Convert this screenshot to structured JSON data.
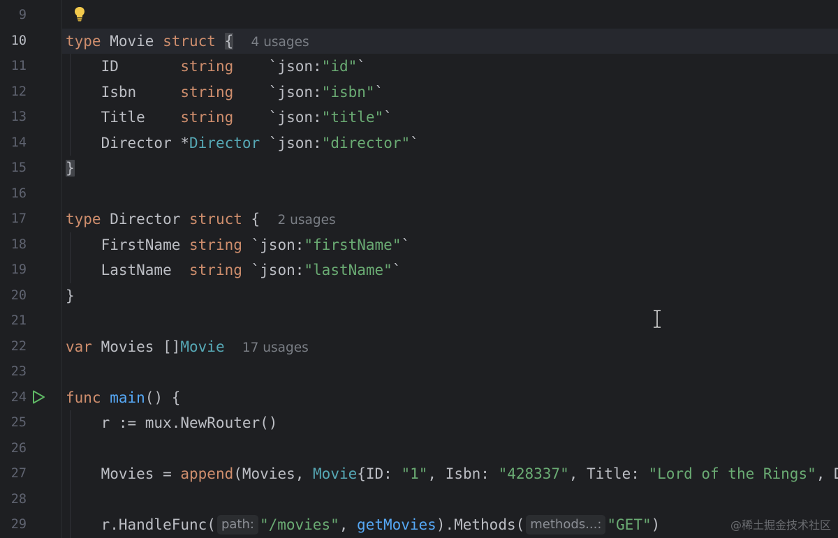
{
  "editor": {
    "language": "Go",
    "colors": {
      "background": "#1e1f22",
      "keyword": "#cf8e6d",
      "string": "#6aab73",
      "type": "#56a8b5",
      "function": "#56a8f5",
      "plain": "#bcbec4",
      "hint": "#7a7e85",
      "line_number": "#5f6370",
      "run_icon": "#5fb865",
      "bulb_icon": "#f2c94c"
    },
    "current_line": 10,
    "icons": {
      "bulb": "lightbulb-icon",
      "run": "run-gutter-icon",
      "cursor": "text-cursor-icon"
    }
  },
  "lines": [
    {
      "n": "9"
    },
    {
      "n": "10",
      "tokens": [
        {
          "t": "type ",
          "c": "kw"
        },
        {
          "t": "Movie ",
          "c": "plain"
        },
        {
          "t": "struct ",
          "c": "kw"
        },
        {
          "t": "{",
          "c": "plain",
          "brace": true
        },
        {
          "t": "  ",
          "c": "plain"
        },
        {
          "t": "4 usages",
          "c": "hint"
        }
      ]
    },
    {
      "n": "11",
      "tokens": [
        {
          "t": "    ID       ",
          "c": "plain"
        },
        {
          "t": "string",
          "c": "kw"
        },
        {
          "t": "    `json:",
          "c": "plain"
        },
        {
          "t": "\"id\"",
          "c": "str"
        },
        {
          "t": "`",
          "c": "plain"
        }
      ]
    },
    {
      "n": "12",
      "tokens": [
        {
          "t": "    Isbn     ",
          "c": "plain"
        },
        {
          "t": "string",
          "c": "kw"
        },
        {
          "t": "    `json:",
          "c": "plain"
        },
        {
          "t": "\"isbn\"",
          "c": "str"
        },
        {
          "t": "`",
          "c": "plain"
        }
      ]
    },
    {
      "n": "13",
      "tokens": [
        {
          "t": "    Title    ",
          "c": "plain"
        },
        {
          "t": "string",
          "c": "kw"
        },
        {
          "t": "    `json:",
          "c": "plain"
        },
        {
          "t": "\"title\"",
          "c": "str"
        },
        {
          "t": "`",
          "c": "plain"
        }
      ]
    },
    {
      "n": "14",
      "tokens": [
        {
          "t": "    Director *",
          "c": "plain"
        },
        {
          "t": "Director",
          "c": "typ"
        },
        {
          "t": " `json:",
          "c": "plain"
        },
        {
          "t": "\"director\"",
          "c": "str"
        },
        {
          "t": "`",
          "c": "plain"
        }
      ]
    },
    {
      "n": "15",
      "tokens": [
        {
          "t": "}",
          "c": "plain",
          "brace": true
        }
      ]
    },
    {
      "n": "16"
    },
    {
      "n": "17",
      "tokens": [
        {
          "t": "type ",
          "c": "kw"
        },
        {
          "t": "Director ",
          "c": "plain"
        },
        {
          "t": "struct ",
          "c": "kw"
        },
        {
          "t": "{",
          "c": "plain"
        },
        {
          "t": "  ",
          "c": "plain"
        },
        {
          "t": "2 usages",
          "c": "hint"
        }
      ]
    },
    {
      "n": "18",
      "tokens": [
        {
          "t": "    FirstName ",
          "c": "plain"
        },
        {
          "t": "string",
          "c": "kw"
        },
        {
          "t": " `json:",
          "c": "plain"
        },
        {
          "t": "\"firstName\"",
          "c": "str"
        },
        {
          "t": "`",
          "c": "plain"
        }
      ]
    },
    {
      "n": "19",
      "tokens": [
        {
          "t": "    LastName  ",
          "c": "plain"
        },
        {
          "t": "string",
          "c": "kw"
        },
        {
          "t": " `json:",
          "c": "plain"
        },
        {
          "t": "\"lastName\"",
          "c": "str"
        },
        {
          "t": "`",
          "c": "plain"
        }
      ]
    },
    {
      "n": "20",
      "tokens": [
        {
          "t": "}",
          "c": "plain"
        }
      ]
    },
    {
      "n": "21"
    },
    {
      "n": "22",
      "tokens": [
        {
          "t": "var ",
          "c": "kw"
        },
        {
          "t": "Movies []",
          "c": "plain"
        },
        {
          "t": "Movie",
          "c": "typ"
        },
        {
          "t": "  ",
          "c": "plain"
        },
        {
          "t": "17 usages",
          "c": "hint"
        }
      ]
    },
    {
      "n": "23"
    },
    {
      "n": "24",
      "tokens": [
        {
          "t": "func ",
          "c": "kw"
        },
        {
          "t": "main",
          "c": "fn"
        },
        {
          "t": "() {",
          "c": "plain"
        }
      ]
    },
    {
      "n": "25",
      "tokens": [
        {
          "t": "    r := mux.NewRouter()",
          "c": "plain"
        }
      ]
    },
    {
      "n": "26"
    },
    {
      "n": "27",
      "tokens": [
        {
          "t": "    Movies = ",
          "c": "plain"
        },
        {
          "t": "append",
          "c": "kw"
        },
        {
          "t": "(Movies, ",
          "c": "plain"
        },
        {
          "t": "Movie",
          "c": "typ"
        },
        {
          "t": "{ID: ",
          "c": "plain"
        },
        {
          "t": "\"1\"",
          "c": "str"
        },
        {
          "t": ", Isbn: ",
          "c": "plain"
        },
        {
          "t": "\"428337\"",
          "c": "str"
        },
        {
          "t": ", Title: ",
          "c": "plain"
        },
        {
          "t": "\"Lord of the Rings\"",
          "c": "str"
        },
        {
          "t": ", D",
          "c": "plain"
        }
      ]
    },
    {
      "n": "28"
    },
    {
      "n": "29",
      "tokens": [
        {
          "t": "    r.HandleFunc(",
          "c": "plain"
        },
        {
          "t": "path:",
          "c": "param"
        },
        {
          "t": "\"/movies\"",
          "c": "str"
        },
        {
          "t": ", ",
          "c": "plain"
        },
        {
          "t": "getMovies",
          "c": "fn"
        },
        {
          "t": ").Methods(",
          "c": "plain"
        },
        {
          "t": "methods...:",
          "c": "param"
        },
        {
          "t": "\"GET\"",
          "c": "str"
        },
        {
          "t": ")",
          "c": "plain"
        }
      ]
    }
  ],
  "watermark": "@稀土掘金技术社区"
}
